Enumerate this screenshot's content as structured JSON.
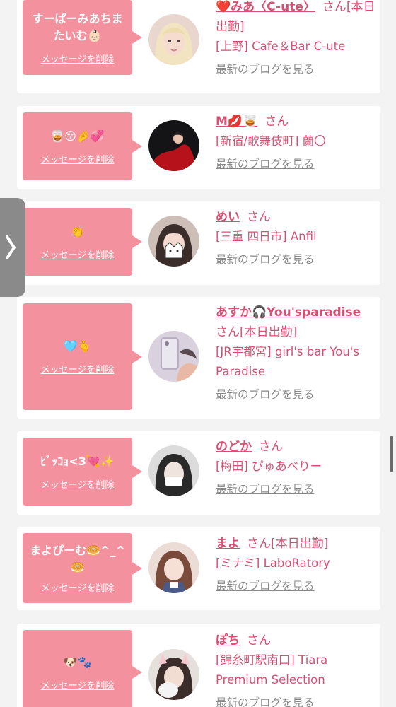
{
  "delete_label": "メッセージを削除",
  "blog_label": "最新のブログを見る",
  "san_label": "さん",
  "side_tab_icon": "chevron-right-icon",
  "colors": {
    "accent": "#f3919f",
    "name": "#d94f73",
    "muted": "#888888"
  },
  "posts": [
    {
      "message": "すーぱーみあちまたいむ👶🏻",
      "name": "❤️みあ〈C-ute〉",
      "san": "さん[本日出勤]",
      "shop": "[上野] Cafe＆Bar C-ute",
      "avatar": "avatar-blonde-girl"
    },
    {
      "message": "🥃😚🤌💞",
      "name": "M💋🥃",
      "san": "さん",
      "shop": "[新宿/歌舞伎町] 蘭〇",
      "avatar": "avatar-red-dress"
    },
    {
      "message": "👏",
      "name": "めい",
      "san": "さん",
      "shop": "[三重 四日市] Anfil",
      "avatar": "avatar-cat-sticker"
    },
    {
      "message": "🩵🫰",
      "name": "あすか🎧You'sparadise",
      "san": "さん[本日出勤]",
      "shop": "[JR宇都宮] girl's bar You's Paradise",
      "avatar": "avatar-phone-selfie"
    },
    {
      "message": "ﾋﾞｯｺｮ<3💘✨",
      "name": "のどか",
      "san": "さん",
      "shop": "[梅田] ぴゅあべりー",
      "avatar": "avatar-mirror-selfie"
    },
    {
      "message": "まよぴーむ🥯^_^🥯",
      "name": "まよ",
      "san": "さん[本日出勤]",
      "shop": "[ミナミ] LaboRatory",
      "avatar": "avatar-idol-costume"
    },
    {
      "message": "🐶🐾",
      "name": "ぽち",
      "san": "さん",
      "shop": "[錦糸町駅南口] Tiara Premium Selection",
      "avatar": "avatar-pet-filter"
    }
  ]
}
